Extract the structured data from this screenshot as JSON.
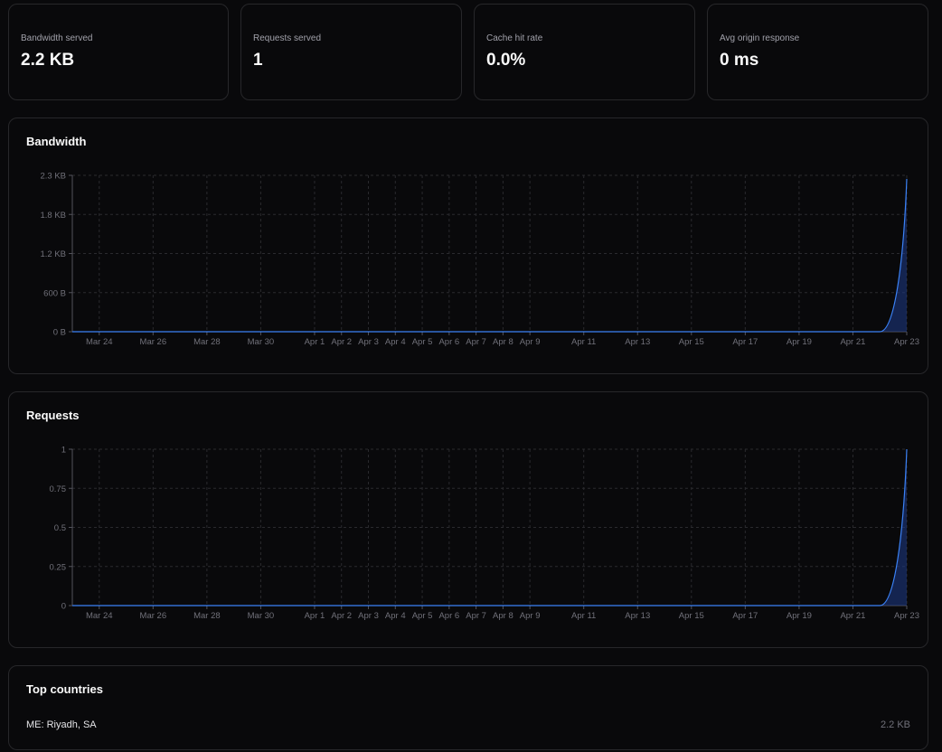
{
  "stats": [
    {
      "label": "Bandwidth served",
      "value": "2.2 KB"
    },
    {
      "label": "Requests served",
      "value": "1"
    },
    {
      "label": "Cache hit rate",
      "value": "0.0%"
    },
    {
      "label": "Avg origin response",
      "value": "0 ms"
    }
  ],
  "colors": {
    "accent": "#3b82f6",
    "fill": "#1e3a8a"
  },
  "chart_data": [
    {
      "type": "area",
      "title": "Bandwidth",
      "y_tick_labels": [
        "0 B",
        "600 B",
        "1.2 KB",
        "1.8 KB",
        "2.3 KB"
      ],
      "x_tick_labels": [
        "Mar 24",
        "Mar 26",
        "Mar 28",
        "Mar 30",
        "Apr 1",
        "Apr 2",
        "Apr 3",
        "Apr 4",
        "Apr 5",
        "Apr 6",
        "Apr 7",
        "Apr 8",
        "Apr 9",
        "Apr 11",
        "Apr 13",
        "Apr 15",
        "Apr 17",
        "Apr 19",
        "Apr 21",
        "Apr 23"
      ],
      "ylim": [
        0,
        2304
      ],
      "series": [
        {
          "x": [
            "Mar 23",
            "Apr 22",
            "Apr 23"
          ],
          "values": [
            0,
            0,
            2252
          ]
        }
      ],
      "grid": true
    },
    {
      "type": "area",
      "title": "Requests",
      "y_tick_labels": [
        "0",
        "0.25",
        "0.5",
        "0.75",
        "1"
      ],
      "x_tick_labels": [
        "Mar 24",
        "Mar 26",
        "Mar 28",
        "Mar 30",
        "Apr 1",
        "Apr 2",
        "Apr 3",
        "Apr 4",
        "Apr 5",
        "Apr 6",
        "Apr 7",
        "Apr 8",
        "Apr 9",
        "Apr 11",
        "Apr 13",
        "Apr 15",
        "Apr 17",
        "Apr 19",
        "Apr 21",
        "Apr 23"
      ],
      "ylim": [
        0,
        1
      ],
      "series": [
        {
          "x": [
            "Mar 23",
            "Apr 22",
            "Apr 23"
          ],
          "values": [
            0,
            0,
            1
          ]
        }
      ],
      "grid": true
    }
  ],
  "top_countries": {
    "title": "Top countries",
    "rows": [
      {
        "name": "ME: Riyadh, SA",
        "value": "2.2 KB"
      }
    ]
  }
}
